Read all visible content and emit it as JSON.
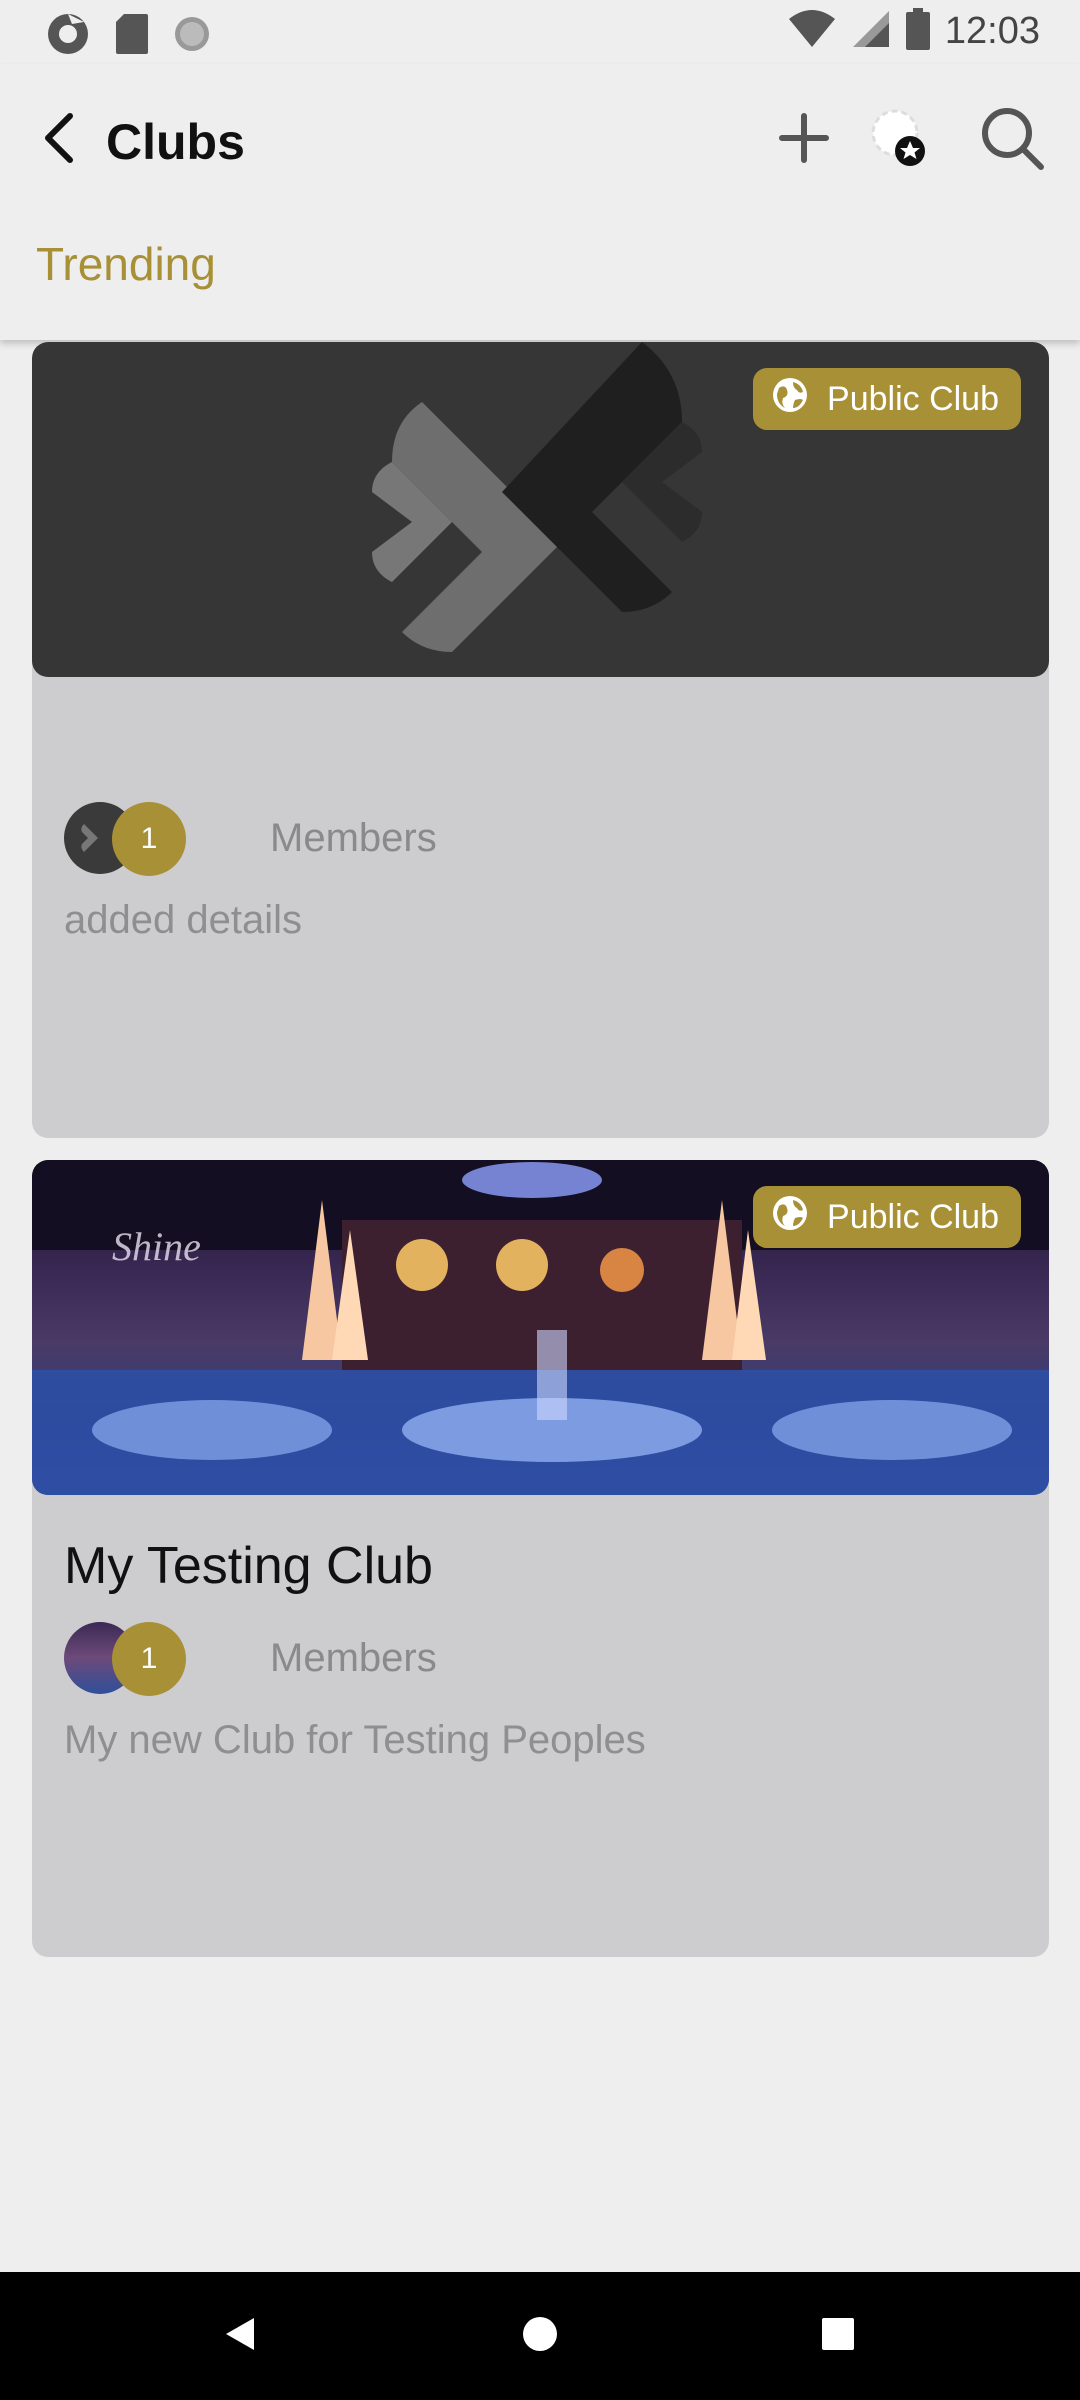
{
  "status_bar": {
    "time": "12:03",
    "icons": [
      "sync-icon",
      "sd-card-icon",
      "loading-icon",
      "wifi-icon",
      "signal-icon",
      "battery-icon"
    ]
  },
  "app_bar": {
    "title": "Clubs",
    "actions": [
      "add-icon",
      "achievement-icon",
      "search-icon"
    ]
  },
  "tabs": {
    "trending": "Trending"
  },
  "clubs": [
    {
      "badge": "Public Club",
      "name": "",
      "member_count": "1",
      "members_label": "Members",
      "description": "added details"
    },
    {
      "badge": "Public Club",
      "name": "My Testing Club",
      "member_count": "1",
      "members_label": "Members",
      "description": "My new Club for Testing Peoples"
    }
  ],
  "colors": {
    "accent": "#a89036",
    "background": "#eeeeee",
    "card": "#cdcdd0"
  }
}
